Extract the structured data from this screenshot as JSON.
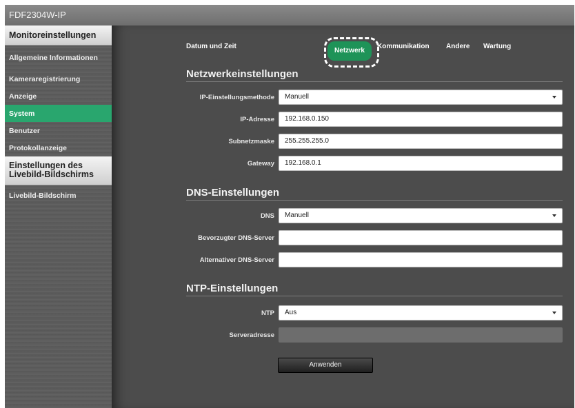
{
  "window": {
    "title": "FDF2304W-IP"
  },
  "sidebar": {
    "section1_title": "Monitoreinstellungen",
    "items": [
      {
        "label": "Allgemeine Informationen"
      },
      {
        "label": "Kameraregistrierung"
      },
      {
        "label": "Anzeige"
      },
      {
        "label": "System"
      },
      {
        "label": "Benutzer"
      },
      {
        "label": "Protokollanzeige"
      }
    ],
    "section2_title": "Einstellungen des Livebild-Bildschirms",
    "items2": [
      {
        "label": "Livebild-Bildschirm"
      }
    ],
    "active_color": "#29a66e"
  },
  "tabs": {
    "items": [
      {
        "label": "Datum und Zeit"
      },
      {
        "label": "Netzwerk"
      },
      {
        "label": "Kommunikation"
      },
      {
        "label": "Andere"
      },
      {
        "label": "Wartung"
      }
    ],
    "active": "Netzwerk",
    "active_color": "#1e9358"
  },
  "network": {
    "title": "Netzwerkeinstellungen",
    "ip_method": {
      "label": "IP-Einstellungsmethode",
      "value": "Manuell"
    },
    "ip_address": {
      "label": "IP-Adresse",
      "value": "192.168.0.150"
    },
    "subnet": {
      "label": "Subnetzmaske",
      "value": "255.255.255.0"
    },
    "gateway": {
      "label": "Gateway",
      "value": "192.168.0.1"
    }
  },
  "dns": {
    "title": "DNS-Einstellungen",
    "mode": {
      "label": "DNS",
      "value": "Manuell"
    },
    "preferred": {
      "label": "Bevorzugter DNS-Server",
      "value": ""
    },
    "alternative": {
      "label": "Alternativer DNS-Server",
      "value": ""
    }
  },
  "ntp": {
    "title": "NTP-Einstellungen",
    "mode": {
      "label": "NTP",
      "value": "Aus"
    },
    "server": {
      "label": "Serveradresse",
      "value": ""
    }
  },
  "actions": {
    "apply_label": "Anwenden"
  }
}
